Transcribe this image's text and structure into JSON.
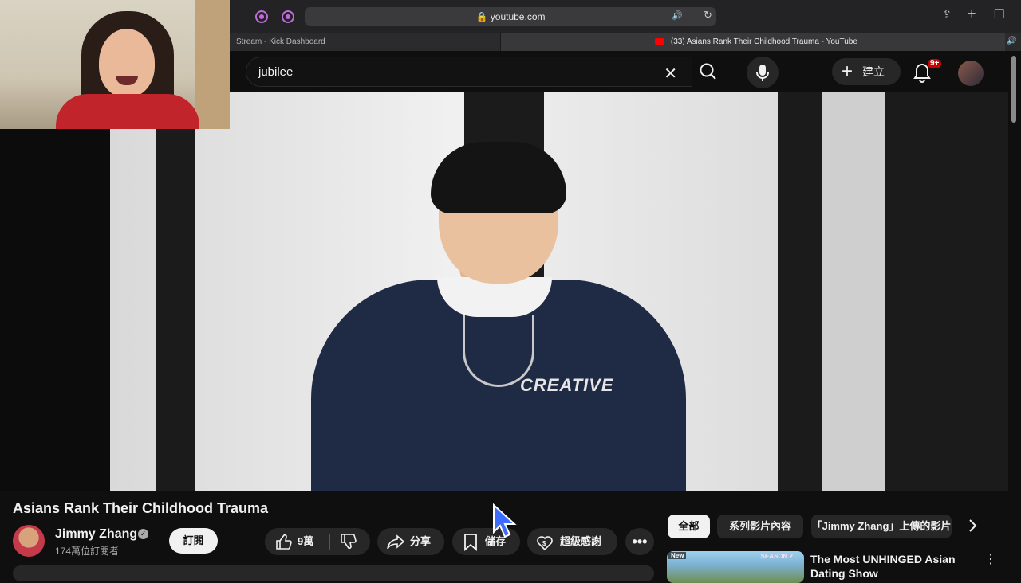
{
  "browser": {
    "url": "youtube.com",
    "tabs": [
      {
        "label": "Stream - Kick Dashboard"
      },
      {
        "label": "(33) Asians Rank Their Childhood Trauma - YouTube"
      }
    ]
  },
  "header": {
    "search_value": "jubilee",
    "create_label": "建立",
    "notification_badge": "9+"
  },
  "video": {
    "shirt_text": "CREATIVE",
    "title": "Asians Rank Their Childhood Trauma"
  },
  "channel": {
    "name": "Jimmy Zhang",
    "subscribers": "174萬位訂閱者",
    "subscribe_label": "訂閱"
  },
  "actions": {
    "likes": "9萬",
    "share": "分享",
    "save": "儲存",
    "thanks": "超級感謝"
  },
  "chips": {
    "all": "全部",
    "series": "系列影片內容",
    "channel": "「Jimmy Zhang」上傳的影片"
  },
  "related": {
    "badge": "New",
    "season": "SEASON 2",
    "title": "The Most UNHINGED Asian Dating Show"
  },
  "colors": {
    "accent_purple": "#c06bdc",
    "badge_red": "#cc0000",
    "cursor_blue": "#3d6cff"
  }
}
